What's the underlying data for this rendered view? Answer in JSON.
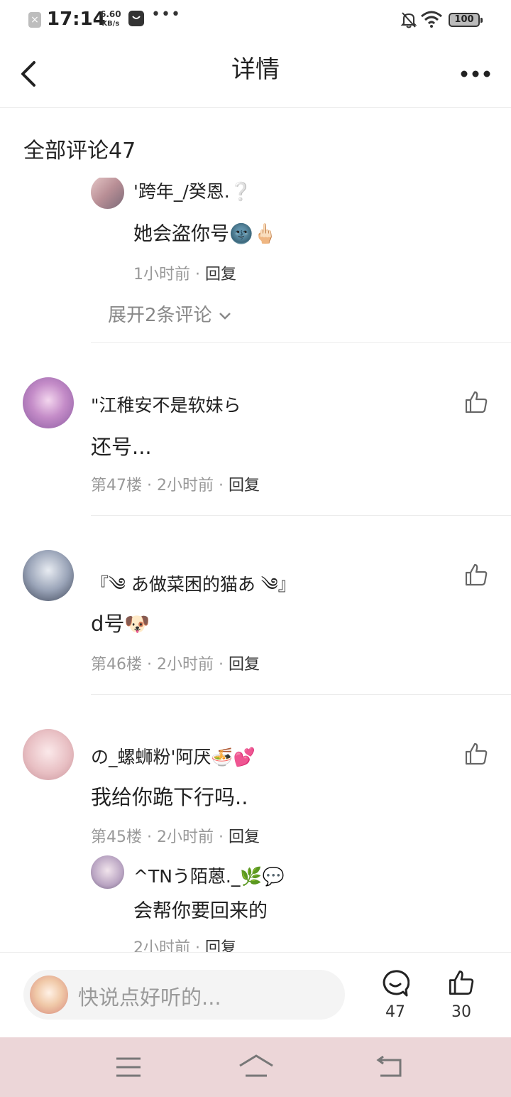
{
  "status_bar": {
    "time": "17:14",
    "speed_value": "6.60",
    "speed_unit": "KB/s",
    "more": "•••",
    "battery": "100"
  },
  "header": {
    "title": "详情"
  },
  "section_title": "全部评论47",
  "top_partial": {
    "reply_name": "'跨年_/癸恩.❔",
    "reply_text": "她会盗你号🌚🖕🏻",
    "reply_meta": "1小时前 · ",
    "reply_label": "回复",
    "expand_label": "展开2条评论"
  },
  "comments": [
    {
      "name": "\"江稚安不是软妹ら",
      "text": "还号...",
      "meta": "第47楼 · 2小时前 · ",
      "reply_label": "回复"
    },
    {
      "name": "『༄ あ做菜困的猫あ ༄』",
      "text": "d号🐶",
      "meta": "第46楼 · 2小时前 · ",
      "reply_label": "回复"
    },
    {
      "name": "の_螺蛳粉'阿厌🍜💕",
      "text": "我给你跪下行吗..",
      "meta": "第45楼 · 2小时前 · ",
      "reply_label": "回复",
      "sub_reply": {
        "name": "^TNう陌蒽._🌿💬",
        "text": "会帮你要回来的",
        "meta": "2小时前 · ",
        "reply_label": "回复"
      }
    }
  ],
  "bottom_bar": {
    "placeholder": "快说点好听的...",
    "comment_count": "47",
    "like_count": "30"
  },
  "colors": {
    "navbar_bg": "#ecd6d8",
    "meta_gray": "#999999"
  }
}
